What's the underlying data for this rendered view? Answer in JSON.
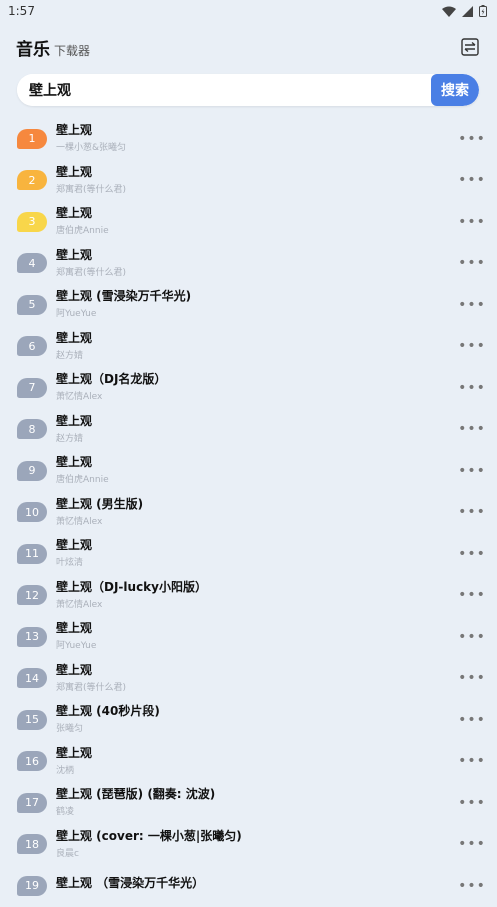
{
  "status": {
    "time": "1:57"
  },
  "header": {
    "title": "音乐",
    "subtitle": "下载器"
  },
  "search": {
    "value": "壁上观",
    "button_label": "搜索"
  },
  "more_glyph": "•••",
  "songs": [
    {
      "rank": "1",
      "title": "壁上观",
      "artist": "一棵小葱&张曦匀"
    },
    {
      "rank": "2",
      "title": "壁上观",
      "artist": "郑寓君(等什么君)"
    },
    {
      "rank": "3",
      "title": "壁上观",
      "artist": "唐伯虎Annie"
    },
    {
      "rank": "4",
      "title": "壁上观",
      "artist": "郑寓君(等什么君)"
    },
    {
      "rank": "5",
      "title": "壁上观 (雪浸染万千华光)",
      "artist": "阿YueYue"
    },
    {
      "rank": "6",
      "title": "壁上观",
      "artist": "赵方婧"
    },
    {
      "rank": "7",
      "title": "壁上观（DJ名龙版）",
      "artist": "萧忆情Alex"
    },
    {
      "rank": "8",
      "title": "壁上观",
      "artist": "赵方婧"
    },
    {
      "rank": "9",
      "title": "壁上观",
      "artist": "唐伯虎Annie"
    },
    {
      "rank": "10",
      "title": "壁上观 (男生版)",
      "artist": "萧忆情Alex"
    },
    {
      "rank": "11",
      "title": "壁上观",
      "artist": "叶炫清"
    },
    {
      "rank": "12",
      "title": "壁上观（DJ-lucky小阳版）",
      "artist": "萧忆情Alex"
    },
    {
      "rank": "13",
      "title": "壁上观",
      "artist": "阿YueYue"
    },
    {
      "rank": "14",
      "title": "壁上观",
      "artist": "郑寓君(等什么君)"
    },
    {
      "rank": "15",
      "title": "壁上观 (40秒片段)",
      "artist": "张曦匀"
    },
    {
      "rank": "16",
      "title": "壁上观",
      "artist": "沈柄"
    },
    {
      "rank": "17",
      "title": "壁上观 (琵琶版) (翻奏: 沈波)",
      "artist": "鹤凌"
    },
    {
      "rank": "18",
      "title": "壁上观 (cover: 一棵小葱|张曦匀)",
      "artist": "良晨c"
    },
    {
      "rank": "19",
      "title": "壁上观 （雪浸染万千华光）",
      "artist": ""
    }
  ]
}
